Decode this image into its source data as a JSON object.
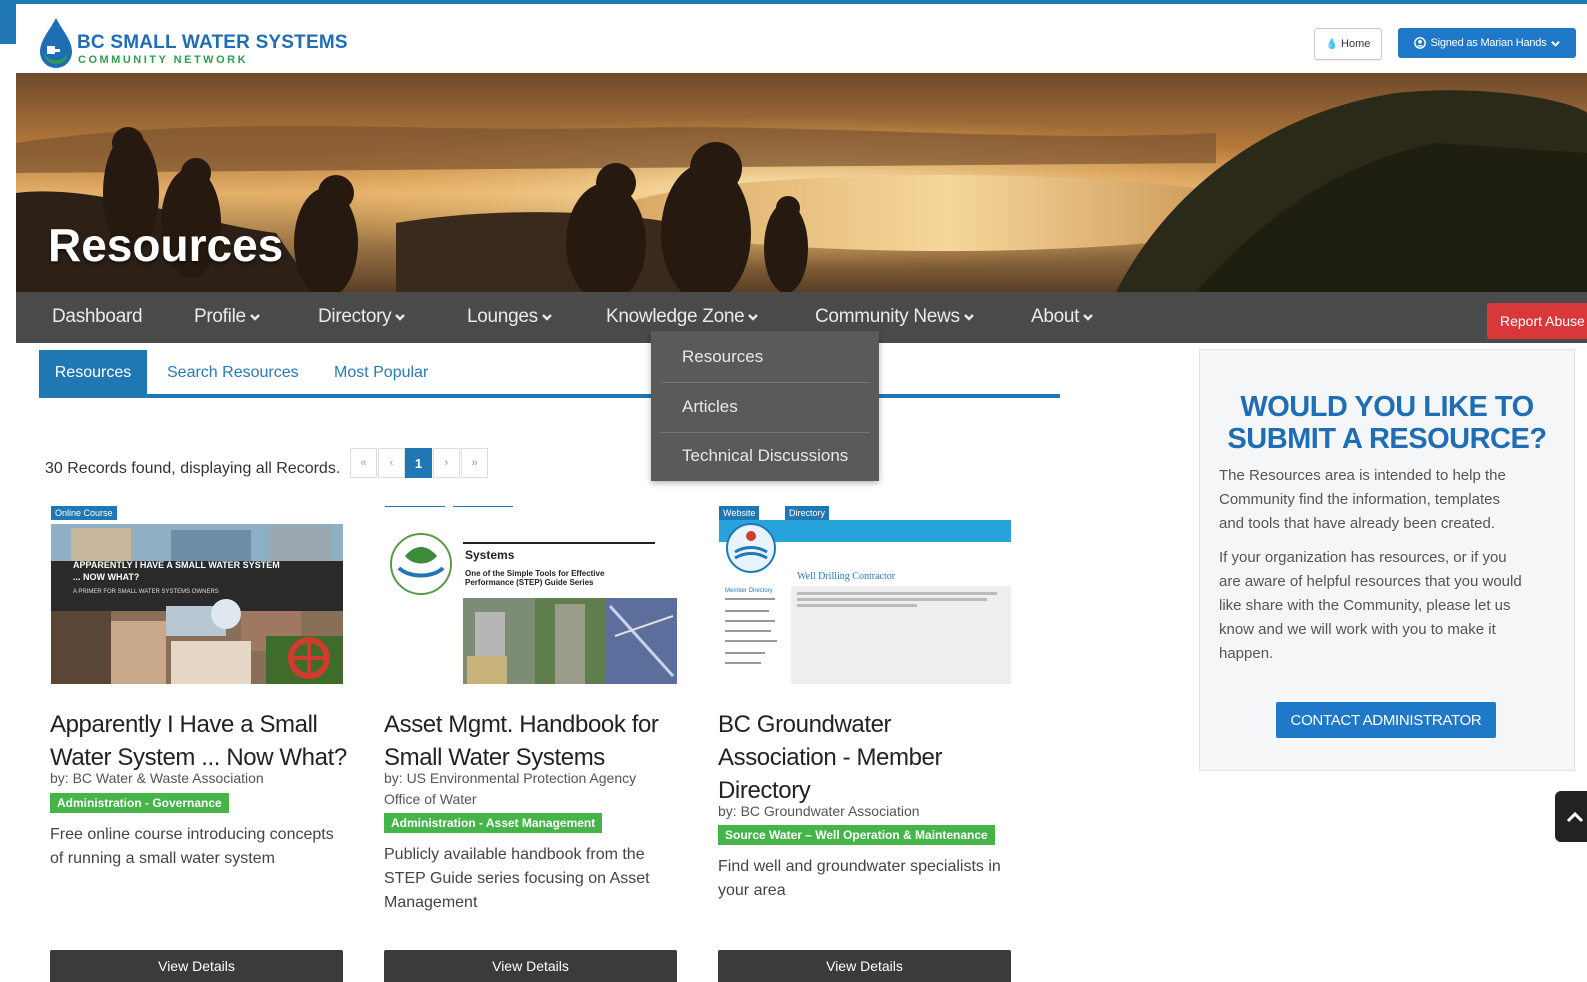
{
  "header": {
    "logo_title": "BC SMALL WATER SYSTEMS",
    "logo_subtitle": "COMMUNITY NETWORK",
    "home_label": "Home",
    "signed_label": "Signed as Marian Hands"
  },
  "hero": {
    "title": "Resources"
  },
  "nav": {
    "items": [
      {
        "label": "Dashboard"
      },
      {
        "label": "Profile"
      },
      {
        "label": "Directory"
      },
      {
        "label": "Lounges"
      },
      {
        "label": "Knowledge Zone"
      },
      {
        "label": "Community News"
      },
      {
        "label": "About"
      }
    ],
    "report_label": "Report Abuse"
  },
  "dropdown": {
    "items": [
      {
        "label": "Resources"
      },
      {
        "label": "Articles"
      },
      {
        "label": "Technical Discussions"
      }
    ]
  },
  "tabs": [
    {
      "label": "Resources"
    },
    {
      "label": "Search Resources"
    },
    {
      "label": "Most Popular"
    }
  ],
  "records": {
    "summary": "30 Records found, displaying all Records.",
    "pagination": [
      "«",
      "‹",
      "1",
      "›",
      "»"
    ]
  },
  "cards": [
    {
      "badges": [
        "Online Course"
      ],
      "thumb_text": [
        "APPARENTLY I HAVE A SMALL WATER SYSTEM",
        "... NOW WHAT?",
        "A PRIMER FOR SMALL WATER SYSTEMS OWNERS"
      ],
      "title_lines": [
        "Apparently I Have a Small",
        "Water System ... Now What?"
      ],
      "by": "by: BC Water & Waste Association",
      "tag": "Administration - Governance",
      "desc_lines": [
        "Free online course introducing concepts",
        "of running a small water system"
      ],
      "button": "View Details"
    },
    {
      "badges": [],
      "thumb_text": [
        "Systems",
        "One of the Simple Tools for Effective",
        "Performance (STEP) Guide Series"
      ],
      "title_lines": [
        "Asset Mgmt. Handbook for",
        "Small Water Systems"
      ],
      "by_lines": [
        "by: US Environmental Protection Agency",
        "Office of Water"
      ],
      "tag": "Administration - Asset Management",
      "desc_lines": [
        "Publicly available handbook from the",
        "STEP Guide series focusing on Asset",
        "Management"
      ],
      "button": "View Details"
    },
    {
      "badges": [
        "Website",
        "Directory"
      ],
      "thumb_text": [
        "Well Drilling Contractor",
        "Member Directory"
      ],
      "title_lines": [
        "BC Groundwater",
        "Association - Member",
        "Directory"
      ],
      "by": "by: BC Groundwater Association",
      "tag": "Source Water – Well Operation & Maintenance",
      "desc_lines": [
        "Find well and groundwater specialists in",
        "your area"
      ],
      "button": "View Details"
    }
  ],
  "side": {
    "title_lines": [
      "WOULD YOU LIKE TO",
      "SUBMIT A RESOURCE?"
    ],
    "p1_lines": [
      "The Resources area is intended to help the",
      "Community find the information, templates",
      "and tools that have already been created."
    ],
    "p2_lines": [
      "If your organization has resources, or if you",
      "are aware of helpful resources that you would",
      "like share with the Community, please let us",
      "know and we will work with you to make it",
      "happen."
    ],
    "button": "CONTACT ADMINISTRATOR"
  },
  "colors": {
    "brand_blue": "#1f78b4",
    "nav_bg": "#4a4a4a",
    "tag_green": "#45b549",
    "report_red": "#d9383a"
  }
}
